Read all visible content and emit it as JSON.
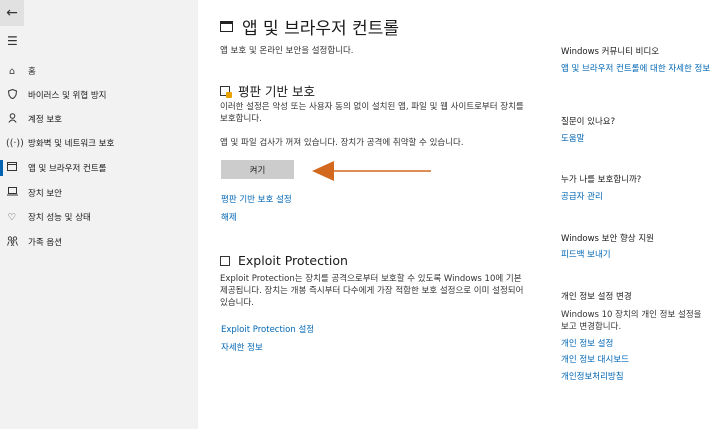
{
  "sidebar": {
    "back_icon": "arrow-left-icon",
    "menu_icon": "hamburger-icon",
    "items": [
      {
        "label": "홈",
        "icon": "home-icon"
      },
      {
        "label": "바이러스 및 위협 방지",
        "icon": "shield-icon"
      },
      {
        "label": "계정 보호",
        "icon": "person-icon"
      },
      {
        "label": "방화벽 및 네트워크 보호",
        "icon": "wifi-icon"
      },
      {
        "label": "앱 및 브라우저 컨트롤",
        "icon": "app-window-icon"
      },
      {
        "label": "장치 보안",
        "icon": "laptop-icon"
      },
      {
        "label": "장치 성능 및 상태",
        "icon": "heart-icon"
      },
      {
        "label": "가족 옵션",
        "icon": "family-icon"
      }
    ],
    "active_index": 4
  },
  "main": {
    "title": "앱 및 브라우저 컨트롤",
    "subtitle": "앱 보호 및 온라인 보안을 설정합니다.",
    "reputation": {
      "heading": "평판 기반 보호",
      "description": "이러한 설정은 악성 또는 사용자 동의 없이 설치된 앱, 파일 및 웹 사이트로부터 장치를 보호합니다.",
      "warning": "앱 및 파일 검사가 꺼져 있습니다. 장치가 공격에 취약할 수 있습니다.",
      "turn_on_label": "켜기",
      "settings_link": "평판 기반 보호 설정",
      "dismiss_link": "해제"
    },
    "exploit": {
      "heading": "Exploit Protection",
      "description": "Exploit Protection는 장치를 공격으로부터 보호할 수 있도록 Windows 10에 기본 제공됩니다. 장치는 개봉 즉시부터 다수에게 가장 적합한 보호 설정으로 이미 설정되어 있습니다.",
      "settings_link": "Exploit Protection 설정",
      "more_link": "자세한 정보"
    }
  },
  "right": {
    "community": {
      "heading": "Windows 커뮤니티 비디오",
      "link": "앱 및 브라우저 컨트롤에 대한 자세한 정보"
    },
    "question": {
      "heading": "질문이 있나요?",
      "link": "도움말"
    },
    "protector": {
      "heading": "누가 나를 보호합니까?",
      "link": "공급자 관리"
    },
    "improve": {
      "heading": "Windows 보안 향상 지원",
      "link": "피드백 보내기"
    },
    "privacy": {
      "heading": "개인 정보 설정 변경",
      "text": "Windows 10 장치의 개인 정보 설정을 보고 변경합니다.",
      "links": [
        "개인 정보 설정",
        "개인 정보 대시보드",
        "개인정보처리방침"
      ]
    }
  },
  "colors": {
    "accent": "#0066b4",
    "arrow": "#d2691e",
    "warning": "#e8a200",
    "sidebar_bg": "#f2f2f2"
  }
}
